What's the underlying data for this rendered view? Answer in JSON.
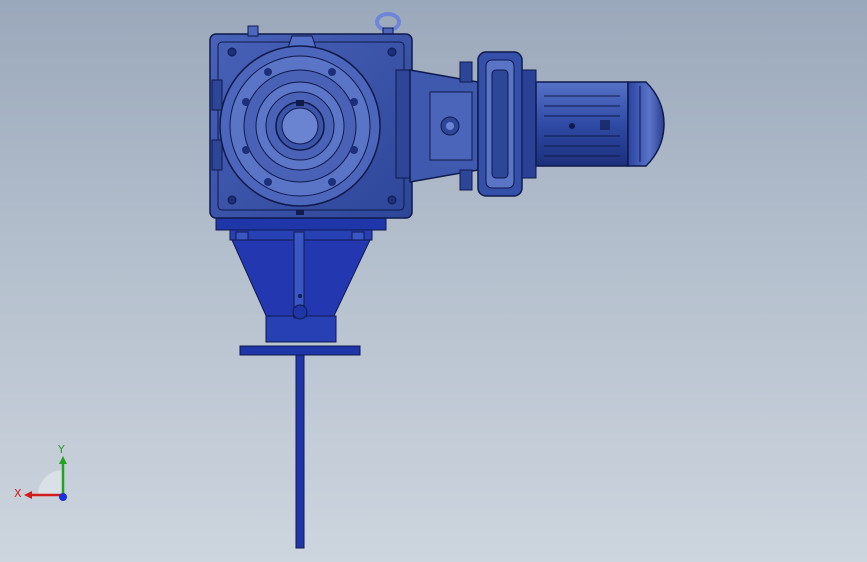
{
  "viewport": {
    "colors": {
      "background_top": "#9aa8bb",
      "background_bottom": "#cdd5de",
      "body_blue": "#3d5bb0",
      "body_dark": "#1c2f7a",
      "edge": "#0f1a4d",
      "stand_blue": "#1f36a8",
      "lifting_eye": "#6f86d8"
    },
    "model": {
      "parts": [
        "gearbox-housing",
        "output-flange",
        "hollow-shaft",
        "input-adapter",
        "brake-disc",
        "motor-body",
        "motor-fan-cover",
        "mounting-stand",
        "base-plate",
        "drive-rod",
        "lifting-eye"
      ]
    },
    "triad": {
      "x_label": "X",
      "y_label": "Y",
      "x_color": "#d21c1c",
      "y_color": "#22a322",
      "z_color": "#1f2fd8"
    }
  }
}
